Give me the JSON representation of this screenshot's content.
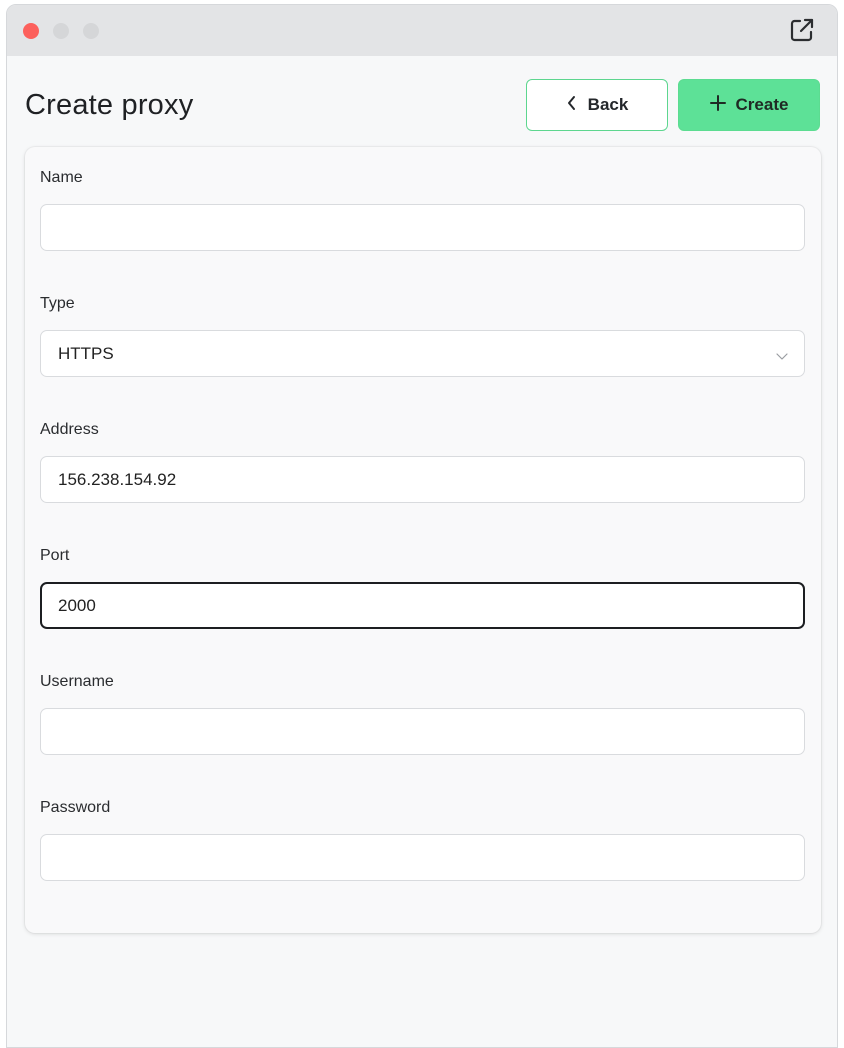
{
  "window": {
    "controls": [
      "close",
      "minimize",
      "maximize"
    ],
    "popout_icon": "external-link-icon"
  },
  "header": {
    "title": "Create proxy",
    "back_label": "Back",
    "back_icon": "chevron-left-icon",
    "create_label": "Create",
    "create_icon": "plus-icon"
  },
  "form": {
    "name": {
      "label": "Name",
      "value": ""
    },
    "type": {
      "label": "Type",
      "value": "HTTPS",
      "icon": "chevron-down-icon"
    },
    "address": {
      "label": "Address",
      "value": "156.238.154.92"
    },
    "port": {
      "label": "Port",
      "value": "2000"
    },
    "username": {
      "label": "Username",
      "value": ""
    },
    "password": {
      "label": "Password",
      "value": ""
    }
  },
  "colors": {
    "accent": "#5de197",
    "accent_border": "#5dd68f",
    "close_dot": "#fc605c"
  }
}
